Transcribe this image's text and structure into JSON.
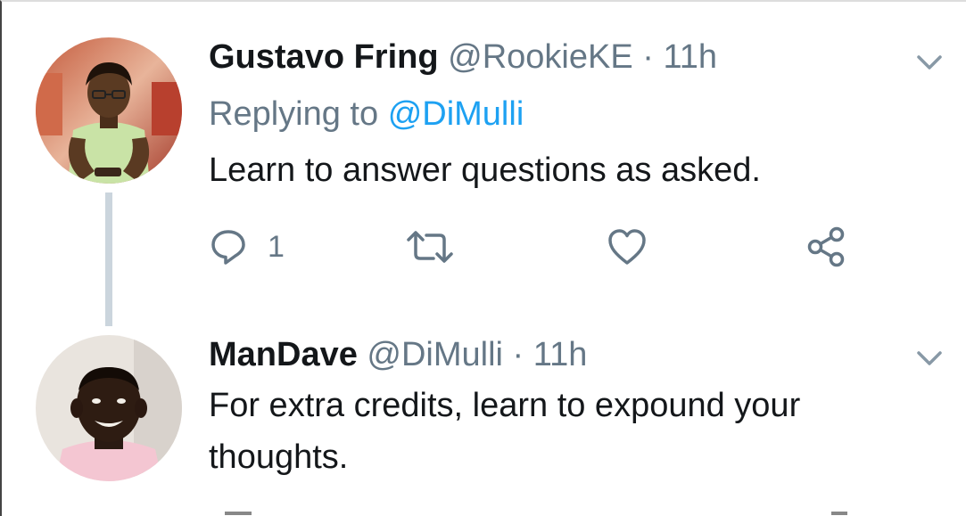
{
  "tweets": [
    {
      "name": "Gustavo Fring",
      "handle": "@RookieKE",
      "separator": "·",
      "time": "11h",
      "replying_prefix": "Replying to",
      "replying_to": "@DiMulli",
      "text": "Learn to answer questions as asked.",
      "reply_count": "1"
    },
    {
      "name": "ManDave",
      "handle": "@DiMulli",
      "separator": "·",
      "time": "11h",
      "text_line1": "For extra credits, learn to expound your",
      "text_line2": "thoughts."
    }
  ],
  "icons": {
    "reply": "reply-icon",
    "retweet": "retweet-icon",
    "like": "heart-icon",
    "share": "share-icon",
    "more": "chevron-down-icon"
  },
  "colors": {
    "text": "#14171a",
    "secondary": "#657786",
    "link": "#1da1f2",
    "thread_line": "#cbd5dd"
  }
}
